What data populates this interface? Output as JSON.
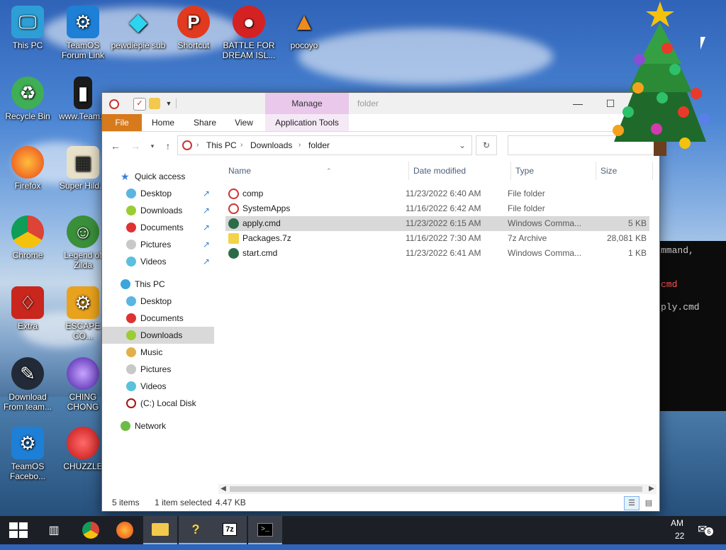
{
  "desktop": {
    "icons": [
      {
        "label": "This PC"
      },
      {
        "label": "TeamOS Forum Link"
      },
      {
        "label": "pewdiepie sub"
      },
      {
        "label": "Shortcut"
      },
      {
        "label": "BATTLE FOR DREAM ISL..."
      },
      {
        "label": "pocoyo"
      },
      {
        "label": "Recycle Bin"
      },
      {
        "label": "www.Team..."
      },
      {
        "label": "Firefox"
      },
      {
        "label": "Super Hild..."
      },
      {
        "label": "Chrome"
      },
      {
        "label": "Legend of Zilda"
      },
      {
        "label": "Extra"
      },
      {
        "label": "ESCAPE CO..."
      },
      {
        "label": "Download From team..."
      },
      {
        "label": "CHING CHONG"
      },
      {
        "label": "TeamOS Facebo..."
      },
      {
        "label": "CHUZZLE"
      }
    ]
  },
  "explorer": {
    "title": "folder",
    "manage_tab": "Manage",
    "ribbon_tabs": [
      "File",
      "Home",
      "Share",
      "View",
      "Application Tools"
    ],
    "address": [
      "This PC",
      "Downloads",
      "folder"
    ],
    "columns": [
      "Name",
      "Date modified",
      "Type",
      "Size"
    ],
    "nav": {
      "quick_access": "Quick access",
      "quick_items": [
        "Desktop",
        "Downloads",
        "Documents",
        "Pictures",
        "Videos"
      ],
      "this_pc": "This PC",
      "pc_items": [
        "Desktop",
        "Documents",
        "Downloads",
        "Music",
        "Pictures",
        "Videos",
        "(C:) Local Disk"
      ],
      "network": "Network"
    },
    "files": [
      {
        "name": "comp",
        "date": "11/23/2022 6:40 AM",
        "type": "File folder",
        "size": ""
      },
      {
        "name": "SystemApps",
        "date": "11/16/2022 6:42 AM",
        "type": "File folder",
        "size": ""
      },
      {
        "name": "apply.cmd",
        "date": "11/23/2022 6:15 AM",
        "type": "Windows Comma...",
        "size": "5 KB"
      },
      {
        "name": "Packages.7z",
        "date": "11/16/2022 7:30 AM",
        "type": "7z Archive",
        "size": "28,081 KB"
      },
      {
        "name": "start.cmd",
        "date": "11/23/2022 6:41 AM",
        "type": "Windows Comma...",
        "size": "1 KB"
      }
    ],
    "status": {
      "items": "5 items",
      "selected": "1 item selected",
      "size": "4.47 KB"
    }
  },
  "terminal": {
    "lines": [
      "mmand,",
      "cmd",
      "ply.cmd"
    ]
  },
  "taskbar": {
    "clock_fragment": "AM",
    "date_fragment": "22",
    "notification_count": "6"
  }
}
